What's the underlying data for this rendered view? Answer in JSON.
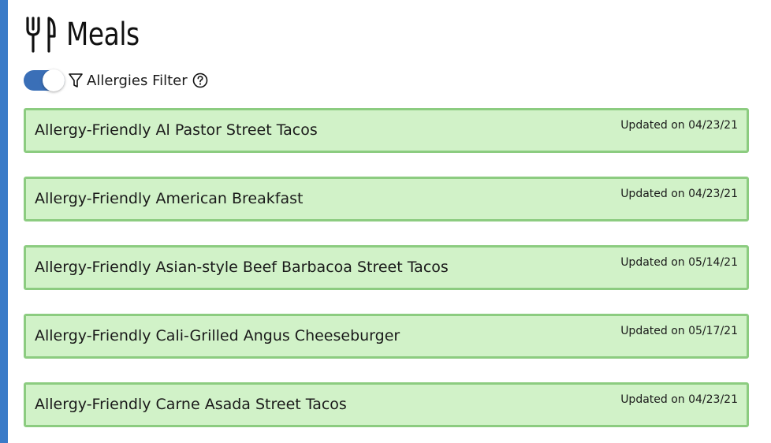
{
  "page": {
    "title": "Meals",
    "title_icon": "utensils-icon"
  },
  "filter": {
    "toggle_on": true,
    "icon": "filter-icon",
    "label": "Allergies Filter",
    "help_icon": "question-circle-icon"
  },
  "meals": [
    {
      "name": "Allergy-Friendly Al Pastor Street Tacos",
      "updated": "Updated on 04/23/21"
    },
    {
      "name": "Allergy-Friendly American Breakfast",
      "updated": "Updated on 04/23/21"
    },
    {
      "name": "Allergy-Friendly Asian-style Beef Barbacoa Street Tacos",
      "updated": "Updated on 05/14/21"
    },
    {
      "name": "Allergy-Friendly Cali-Grilled Angus Cheeseburger",
      "updated": "Updated on 05/17/21"
    },
    {
      "name": "Allergy-Friendly Carne Asada Street Tacos",
      "updated": "Updated on 04/23/21"
    }
  ],
  "colors": {
    "background": "#3a7bc8",
    "toggle_on": "#3a6fb7",
    "card_fill": "#d1f2c8",
    "card_border": "#8ccc80"
  }
}
